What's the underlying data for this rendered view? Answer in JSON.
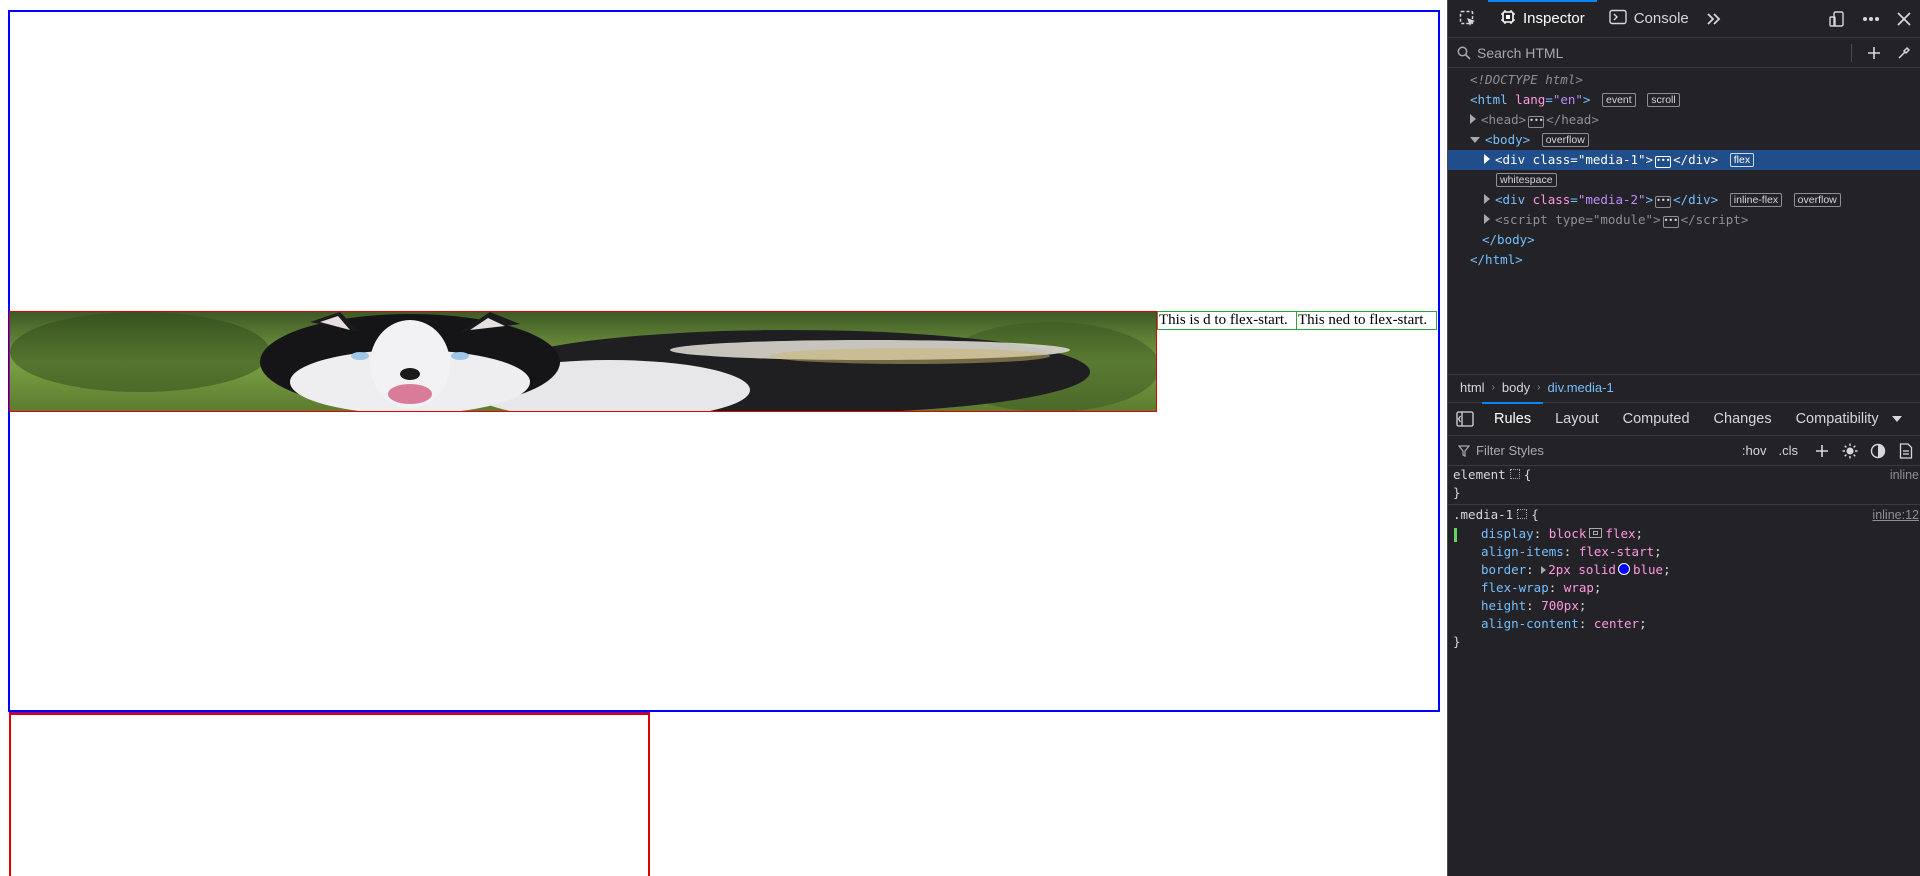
{
  "page": {
    "media1_textboxes": [
      "This is d to flex-start.",
      "This ned to flex-start."
    ],
    "colors": {
      "media1_border": "#0000ff",
      "image_border": "#e00000",
      "text_border": "#2ea43e"
    }
  },
  "devtools": {
    "toolbar": {
      "pick_icon": "element-picker-icon",
      "tabs": [
        {
          "label": "Inspector",
          "icon": "inspector-icon"
        },
        {
          "label": "Console",
          "icon": "console-icon"
        }
      ],
      "more_tabs_icon": "chevrons-right-icon",
      "right_icons": [
        "responsive-design-icon",
        "more-options-icon",
        "close-icon"
      ]
    },
    "search": {
      "placeholder": "Search HTML"
    },
    "tree": {
      "doctype": "<!DOCTYPE html>",
      "html_open": {
        "tag": "html",
        "attr": "lang",
        "value": "\"en\"",
        "badges": [
          "event",
          "scroll"
        ]
      },
      "head": {
        "tag": "head"
      },
      "body_open": {
        "tag": "body",
        "badges": [
          "overflow"
        ]
      },
      "div1": {
        "tag": "div",
        "attr": "class",
        "value": "\"media-1\"",
        "badges": [
          "flex",
          "whitespace"
        ]
      },
      "div2": {
        "tag": "div",
        "attr": "class",
        "value": "\"media-2\"",
        "badges": [
          "inline-flex",
          "overflow"
        ]
      },
      "script": {
        "tag": "script",
        "attr": "type",
        "value": "\"module\""
      },
      "body_close": "</body>",
      "html_close": "</html>"
    },
    "breadcrumbs": [
      "html",
      "body",
      "div.media-1"
    ],
    "sidepanel_tabs": [
      "Rules",
      "Layout",
      "Computed",
      "Changes",
      "Compatibility"
    ],
    "filter": {
      "placeholder": "Filter Styles",
      "hov": ":hov",
      "cls": ".cls"
    },
    "rules": {
      "element": {
        "selector": "element",
        "source": "inline"
      },
      "media1": {
        "selector": ".media-1",
        "source": "inline:12",
        "declarations": [
          {
            "prop": "display",
            "value": "block",
            "value2": "flex"
          },
          {
            "prop": "align-items",
            "value": "flex-start"
          },
          {
            "prop": "border",
            "value": "2px solid",
            "value2": "blue"
          },
          {
            "prop": "flex-wrap",
            "value": "wrap"
          },
          {
            "prop": "height",
            "value": "700px"
          },
          {
            "prop": "align-content",
            "value": "center"
          }
        ]
      }
    }
  }
}
